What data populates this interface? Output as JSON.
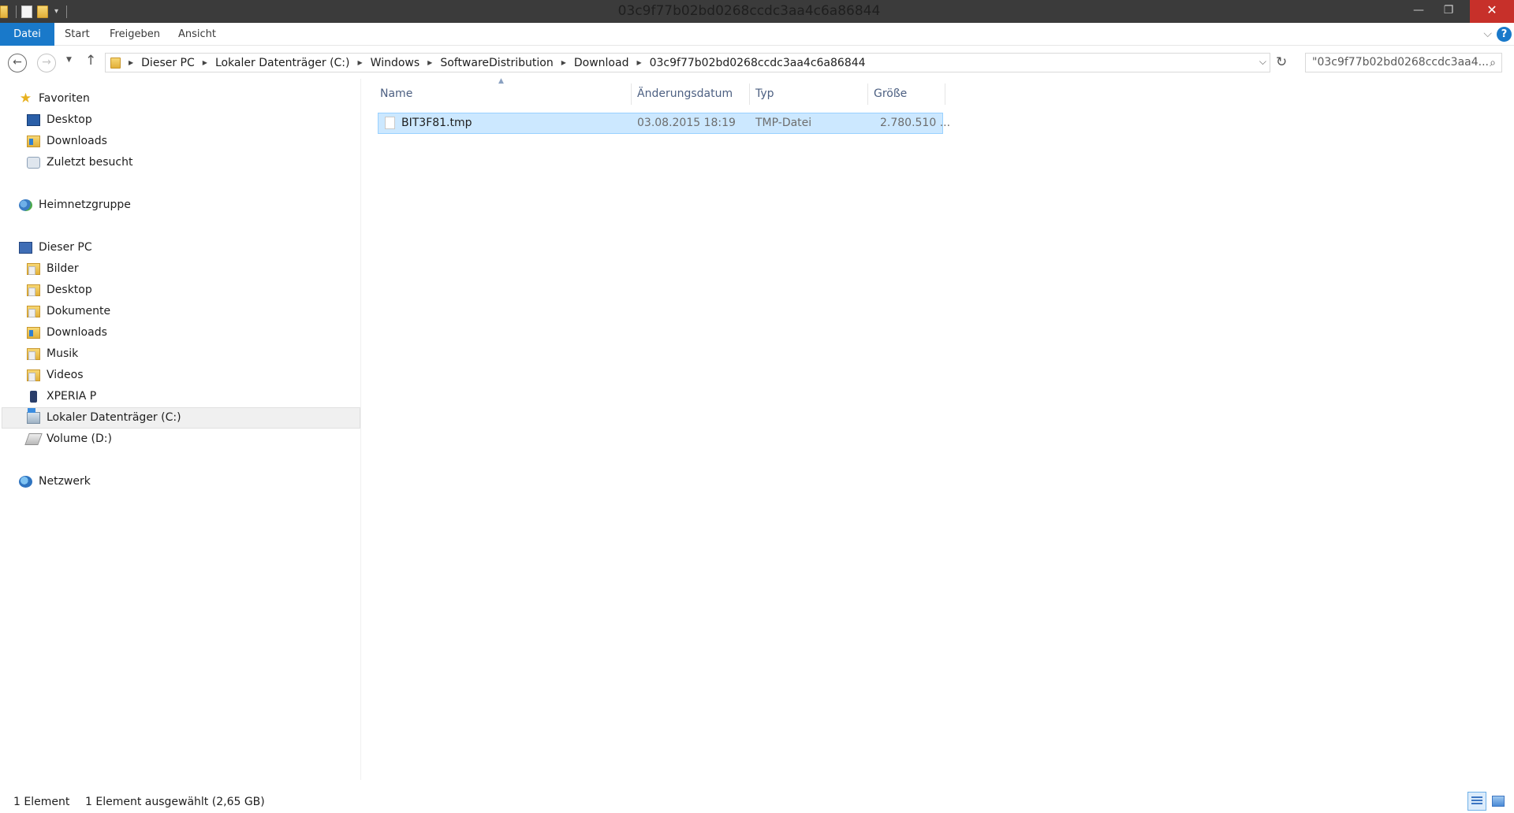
{
  "window": {
    "title": "03c9f77b02bd0268ccdc3aa4c6a86844",
    "minimize_glyph": "—",
    "maximize_glyph": "❐",
    "close_glyph": "✕"
  },
  "quick_access_toolbar": {
    "dropdown_glyph": "▾"
  },
  "ribbon": {
    "tabs": [
      {
        "label": "Datei"
      },
      {
        "label": "Start"
      },
      {
        "label": "Freigeben"
      },
      {
        "label": "Ansicht"
      }
    ],
    "expand_glyph": "⌵",
    "help_glyph": "?"
  },
  "nav_buttons": {
    "back_glyph": "←",
    "forward_glyph": "→",
    "recent_glyph": "▼",
    "up_glyph": "↑",
    "refresh_glyph": "↻"
  },
  "address": {
    "breadcrumbs": [
      "Dieser PC",
      "Lokaler Datenträger (C:)",
      "Windows",
      "SoftwareDistribution",
      "Download",
      "03c9f77b02bd0268ccdc3aa4c6a86844"
    ],
    "separator_glyph": "▶",
    "dropdown_glyph": "⌵"
  },
  "search": {
    "value": "\"03c9f77b02bd0268ccdc3aa4...",
    "icon_glyph": "⌕"
  },
  "sidebar": {
    "favorites": {
      "label": "Favoriten",
      "items": [
        {
          "label": "Desktop",
          "icon": "desktop-icon"
        },
        {
          "label": "Downloads",
          "icon": "downloads-folder-icon"
        },
        {
          "label": "Zuletzt besucht",
          "icon": "recent-places-icon"
        }
      ]
    },
    "homegroup": {
      "label": "Heimnetzgruppe"
    },
    "this_pc": {
      "label": "Dieser PC",
      "items": [
        {
          "label": "Bilder",
          "icon": "pictures-folder-icon"
        },
        {
          "label": "Desktop",
          "icon": "desktop-folder-icon"
        },
        {
          "label": "Dokumente",
          "icon": "documents-folder-icon"
        },
        {
          "label": "Downloads",
          "icon": "downloads-folder-icon"
        },
        {
          "label": "Musik",
          "icon": "music-folder-icon"
        },
        {
          "label": "Videos",
          "icon": "videos-folder-icon"
        },
        {
          "label": "XPERIA P",
          "icon": "phone-icon"
        },
        {
          "label": "Lokaler Datenträger (C:)",
          "icon": "local-drive-icon",
          "selected": true
        },
        {
          "label": "Volume (D:)",
          "icon": "volume-drive-icon"
        }
      ]
    },
    "network": {
      "label": "Netzwerk"
    }
  },
  "file_list": {
    "columns": [
      "Name",
      "Änderungsdatum",
      "Typ",
      "Größe"
    ],
    "sort_glyph": "▲",
    "rows": [
      {
        "name": "BIT3F81.tmp",
        "modified": "03.08.2015 18:19",
        "type": "TMP-Datei",
        "size": "2.780.510 ...",
        "selected": true
      }
    ]
  },
  "status": {
    "count": "1 Element",
    "selection": "1 Element ausgewählt (2,65 GB)"
  },
  "colors": {
    "accent": "#1979ca",
    "selection_bg": "#cce8ff",
    "selection_border": "#99d1ff",
    "titlebar": "#3b3b3b",
    "close": "#c7302a"
  }
}
